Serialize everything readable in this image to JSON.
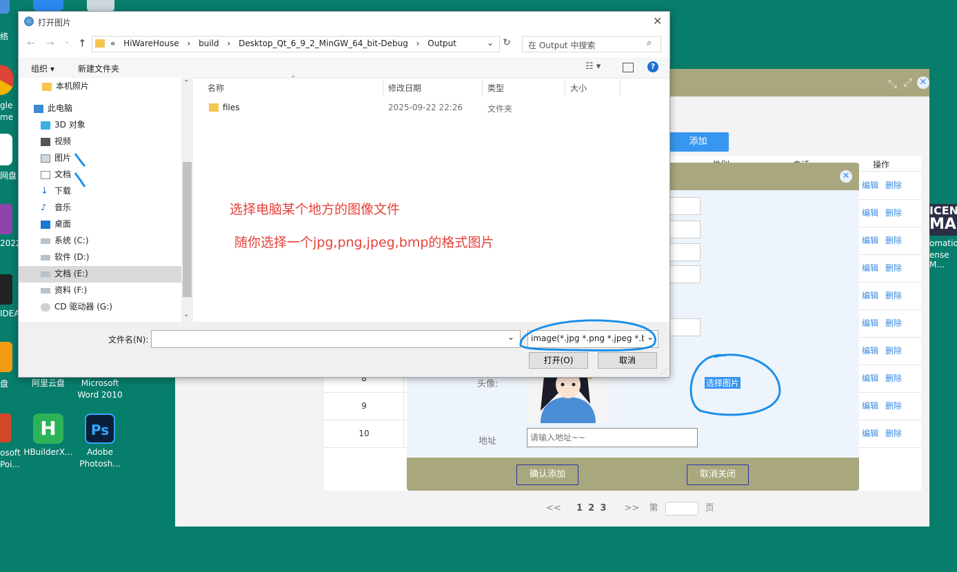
{
  "colors": {
    "desktop": "#077d6b",
    "accent": "#3796f0",
    "title_bar": "#a8a77e",
    "annotation": "#e6423a",
    "circle": "#1a8fe8"
  },
  "desktop": {
    "left_edge_labels": [
      "络",
      "gle",
      "me",
      "网盘",
      "2022",
      "IDEA",
      "盘",
      "osoft",
      "Poi..."
    ],
    "icons": [
      {
        "label": "阿里云盘",
        "icon": "aliyun-icon"
      },
      {
        "label": "Microsoft Word 2010",
        "icon": "word-icon"
      },
      {
        "label": "HBuilderX...",
        "icon": "hbuilder-icon"
      },
      {
        "label": "Adobe Photosh...",
        "icon": "photoshop-icon"
      }
    ],
    "right_edge_labels": [
      "ICEN",
      "MA",
      "omatio",
      "ense M..."
    ]
  },
  "app": {
    "add_button": "添加",
    "columns": [
      "性别",
      "电话",
      "操作"
    ],
    "rows": [
      {
        "no": "",
        "edit": "编辑",
        "delete": "删除"
      },
      {
        "no": "",
        "edit": "编辑",
        "delete": "删除"
      },
      {
        "no": "",
        "edit": "编辑",
        "delete": "删除"
      },
      {
        "no": "",
        "edit": "编辑",
        "delete": "删除"
      },
      {
        "no": "",
        "edit": "编辑",
        "delete": "删除"
      },
      {
        "no": "",
        "edit": "编辑",
        "delete": "删除"
      },
      {
        "no": "",
        "edit": "编辑",
        "delete": "删除"
      },
      {
        "no": "8",
        "edit": "编辑",
        "delete": "删除"
      },
      {
        "no": "9",
        "edit": "编辑",
        "delete": "删除"
      },
      {
        "no": "10",
        "edit": "编辑",
        "delete": "删除"
      }
    ],
    "pager": {
      "prev": "<<",
      "pages": [
        "1",
        "2",
        "3"
      ],
      "next": ">>",
      "di": "第",
      "ye": "页"
    }
  },
  "dialog": {
    "avatar_label": "头像:",
    "choose_image": "选择图片",
    "address_label": "地址",
    "address_placeholder": "请输入地址~~",
    "confirm": "确认添加",
    "cancel": "取消关闭"
  },
  "file_dialog": {
    "title": "打开图片",
    "breadcrumb": [
      "«",
      "HiWareHouse",
      "build",
      "Desktop_Qt_6_9_2_MinGW_64_bit-Debug",
      "Output"
    ],
    "search_placeholder": "在 Output 中搜索",
    "organize": "组织 ▾",
    "new_folder": "新建文件夹",
    "nav": [
      {
        "label": "本机照片",
        "icon": "folder-icon"
      },
      {
        "label": "此电脑",
        "icon": "computer-icon"
      },
      {
        "label": "3D 对象",
        "icon": "cube-icon"
      },
      {
        "label": "视频",
        "icon": "video-icon"
      },
      {
        "label": "图片",
        "icon": "picture-icon"
      },
      {
        "label": "文档",
        "icon": "document-icon"
      },
      {
        "label": "下载",
        "icon": "download-icon"
      },
      {
        "label": "音乐",
        "icon": "music-icon"
      },
      {
        "label": "桌面",
        "icon": "desktop-icon"
      },
      {
        "label": "系统 (C:)",
        "icon": "drive-icon"
      },
      {
        "label": "软件 (D:)",
        "icon": "drive-icon"
      },
      {
        "label": "文档 (E:)",
        "icon": "drive-icon"
      },
      {
        "label": "资料 (F:)",
        "icon": "drive-icon"
      },
      {
        "label": "CD 驱动器 (G:)",
        "icon": "cd-icon"
      }
    ],
    "columns": [
      "名称",
      "修改日期",
      "类型",
      "大小"
    ],
    "files": [
      {
        "name": "files",
        "date": "2025-09-22 22:26",
        "type": "文件夹",
        "size": ""
      }
    ],
    "filename_label": "文件名(N):",
    "filename_value": "",
    "filetype": "image(*.jpg *.png *.jpeg *.br",
    "open": "打开(O)",
    "cancel": "取消"
  },
  "annotations": {
    "line1": "选择电脑某个地方的图像文件",
    "line2": "随你选择一个jpg,png,jpeg,bmp的格式图片"
  }
}
